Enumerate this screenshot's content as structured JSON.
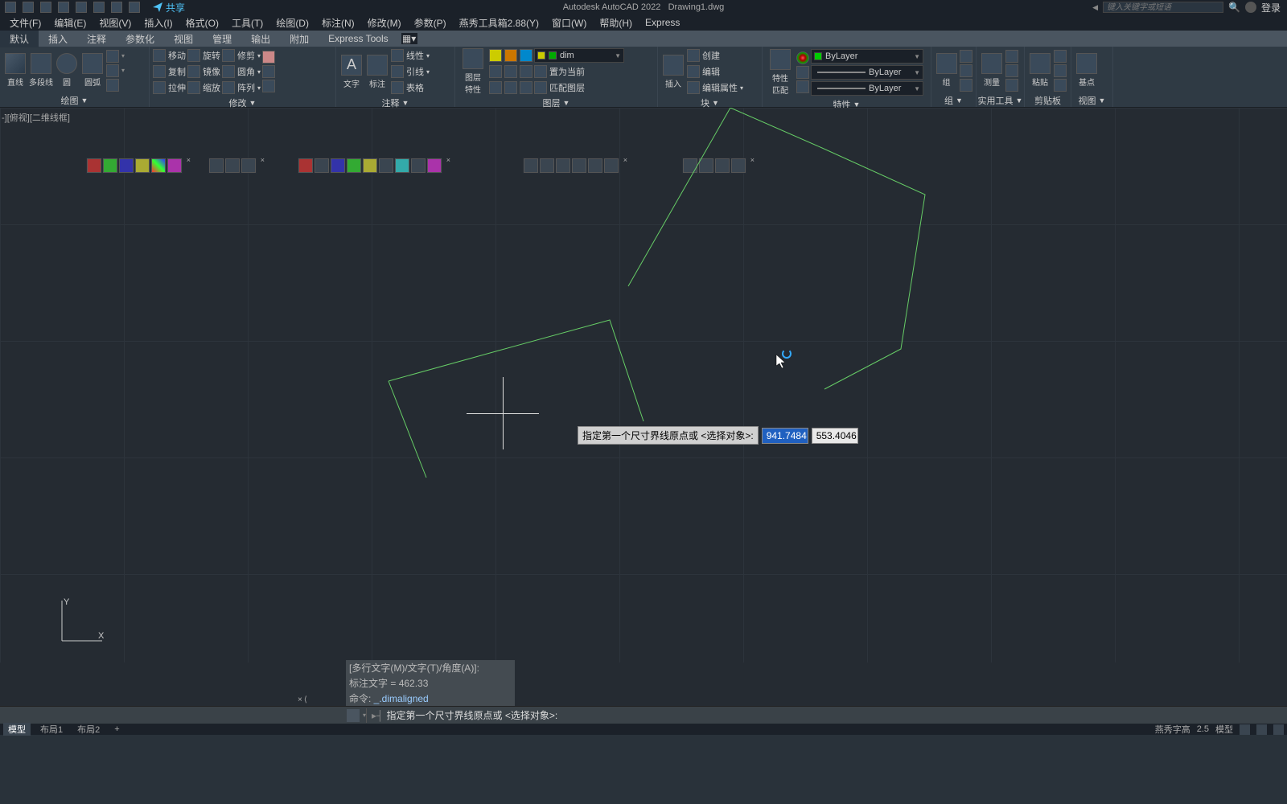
{
  "title_bar": {
    "app_name": "Autodesk AutoCAD 2022",
    "file_name": "Drawing1.dwg",
    "share_label": "共享",
    "search_placeholder": "键入关键字或短语",
    "login_label": "登录"
  },
  "menu": {
    "file": "文件(F)",
    "edit": "编辑(E)",
    "view": "视图(V)",
    "insert": "插入(I)",
    "format": "格式(O)",
    "tools": "工具(T)",
    "draw": "绘图(D)",
    "dimension": "标注(N)",
    "modify": "修改(M)",
    "param": "参数(P)",
    "plugin": "燕秀工具箱2.88(Y)",
    "window": "窗口(W)",
    "help": "帮助(H)",
    "express": "Express"
  },
  "tabs": {
    "default": "默认",
    "insert": "插入",
    "annotate": "注释",
    "parametric": "参数化",
    "view": "视图",
    "manage": "管理",
    "output": "输出",
    "addins": "附加",
    "express": "Express Tools"
  },
  "ribbon": {
    "draw": {
      "title": "绘图",
      "line": "直线",
      "polyline": "多段线",
      "circle": "圆",
      "arc": "圆弧"
    },
    "modify": {
      "title": "修改",
      "move": "移动",
      "rotate": "旋转",
      "trim": "修剪",
      "copy": "复制",
      "mirror": "镜像",
      "fillet": "圆角",
      "stretch": "拉伸",
      "scale": "缩放",
      "array": "阵列"
    },
    "annotate": {
      "title": "注释",
      "text": "文字",
      "dim": "标注",
      "linear": "线性",
      "leader": "引线",
      "table": "表格"
    },
    "layers": {
      "title": "图层",
      "props": "图层\n特性",
      "current_layer": "dim",
      "set_current": "置为当前",
      "match": "匹配图层"
    },
    "block": {
      "title": "块",
      "insert": "插入",
      "create": "创建",
      "edit": "编辑",
      "attr": "编辑属性"
    },
    "properties": {
      "title": "特性",
      "match": "特性\n匹配",
      "bylayer": "ByLayer"
    },
    "groups": {
      "title": "组",
      "group": "组"
    },
    "utilities": {
      "title": "实用工具",
      "measure": "测量"
    },
    "clipboard": {
      "title": "剪贴板",
      "paste": "粘贴"
    },
    "view": {
      "title": "视图",
      "base": "基点"
    }
  },
  "viewport": {
    "label_prefix": "-][俯视][二维线框]"
  },
  "dynamic_input": {
    "prompt": "指定第一个尺寸界线原点或 <选择对象>:",
    "x": "941.7484",
    "y": "553.4046"
  },
  "ucs": {
    "x": "X",
    "y": "Y"
  },
  "cmd_history": {
    "line1": "[多行文字(M)/文字(T)/角度(A)]:",
    "line2_label": "标注文字 = ",
    "line2_value": "462.33",
    "line3_label": "命令: ",
    "line3_value": "_.dimaligned"
  },
  "command_bar": {
    "prompt_prefix": "▸┤",
    "prompt": "指定第一个尺寸界线原点或 <选择对象>:"
  },
  "status": {
    "model": "模型",
    "layout1": "布局1",
    "layout2": "布局2",
    "add": "+",
    "right_text1": "燕秀字高",
    "right_text2": "2.5",
    "right_text3": "模型"
  }
}
